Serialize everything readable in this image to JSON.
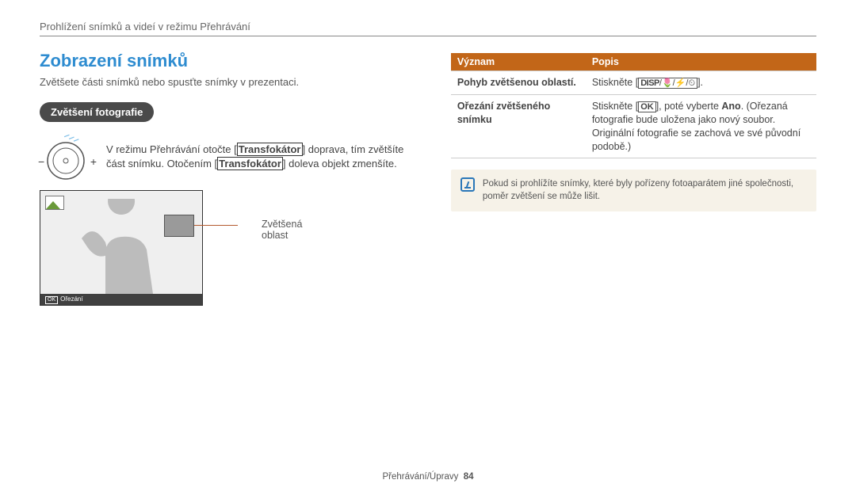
{
  "breadcrumb": "Prohlížení snímků a videí v režimu Přehrávání",
  "main": {
    "heading": "Zobrazení snímků",
    "intro": "Zvětšete části snímků nebo spusťte snímky v prezentaci.",
    "subheading": "Zvětšení fotografie",
    "zoom_text_1": "V režimu Přehrávání otočte [",
    "zoom_bold_1": "Transfokátor",
    "zoom_text_2": "] doprava, tím zvětšíte část snímku. Otočením [",
    "zoom_bold_2": "Transfokátor",
    "zoom_text_3": "] doleva objekt zmenšíte.",
    "screen_footer": "Ořezání",
    "callout": "Zvětšená oblast",
    "minus": "−",
    "plus": "+"
  },
  "table": {
    "header_meaning": "Význam",
    "header_desc": "Popis",
    "row1_label": "Pohyb zvětšenou oblastí.",
    "row1_desc_1": "Stiskněte [",
    "row1_disp": "DISP",
    "row1_desc_2": "/",
    "row1_sym_macro": "🌷",
    "row1_sym_flash": "⚡",
    "row1_sym_timer": "⏲",
    "row1_desc_3": "].",
    "row2_label": "Ořezání zvětšeného snímku",
    "row2_desc_1": "Stiskněte [",
    "row2_ok": "OK",
    "row2_desc_2": "], poté vyberte ",
    "row2_bold": "Ano",
    "row2_desc_3": ". (Ořezaná fotografie bude uložena jako nový soubor. Originální fotografie se zachová ve své původní podobě.)"
  },
  "note": "Pokud si prohlížíte snímky, které byly pořízeny fotoaparátem jiné společnosti, poměr zvětšení se může lišit.",
  "footer": {
    "section": "Přehrávání/Úpravy",
    "page": "84"
  }
}
